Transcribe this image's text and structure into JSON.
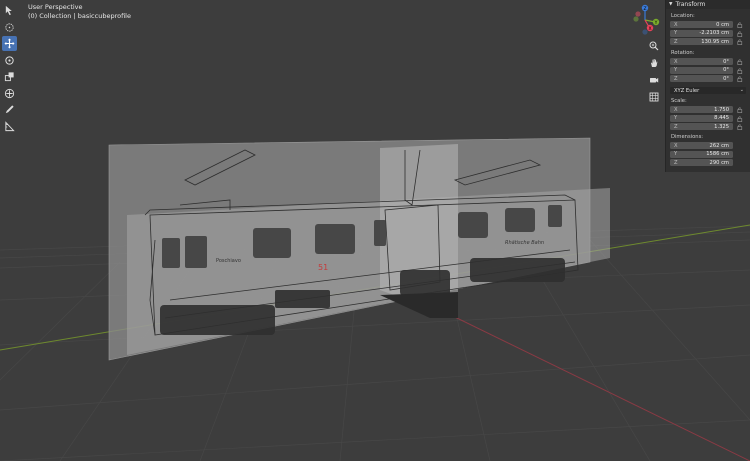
{
  "header": {
    "view_name": "User Perspective",
    "collection_path": "(0) Collection | basiccubeprofile"
  },
  "toolbar": {
    "tools": [
      "select-box-icon",
      "cursor-icon",
      "move-icon",
      "rotate-icon",
      "scale-icon",
      "transform-icon",
      "annotate-icon",
      "measure-icon"
    ],
    "active_tool": "move-icon"
  },
  "nav_buttons": [
    "zoom-icon",
    "hand-pan-icon",
    "camera-icon",
    "grid-view-icon"
  ],
  "gizmo": {
    "labels": {
      "z": "Z",
      "y": "Y",
      "x": "X"
    },
    "colors": {
      "x": "#e8425a",
      "y": "#7aac2c",
      "z": "#3a7ad8"
    }
  },
  "transform": {
    "title": "Transform",
    "location_label": "Location:",
    "location": [
      {
        "axis": "X",
        "value": "0 cm"
      },
      {
        "axis": "Y",
        "value": "-2.2103 cm"
      },
      {
        "axis": "Z",
        "value": "130.95 cm"
      }
    ],
    "rotation_label": "Rotation:",
    "rotation": [
      {
        "axis": "X",
        "value": "0°"
      },
      {
        "axis": "Y",
        "value": "0°"
      },
      {
        "axis": "Z",
        "value": "0°"
      }
    ],
    "rotation_mode": "XYZ Euler",
    "scale_label": "Scale:",
    "scale": [
      {
        "axis": "X",
        "value": "1.750"
      },
      {
        "axis": "Y",
        "value": "8.445"
      },
      {
        "axis": "Z",
        "value": "1.325"
      }
    ],
    "dimensions_label": "Dimensions:",
    "dimensions": [
      {
        "axis": "X",
        "value": "262 cm"
      },
      {
        "axis": "Y",
        "value": "1586 cm"
      },
      {
        "axis": "Z",
        "value": "290 cm"
      }
    ]
  },
  "scene": {
    "car_name_text": "Poschiavo",
    "car_number": "51",
    "livery_text": "Rhätische Bahn"
  },
  "colors": {
    "viewport_bg": "#3d3d3d",
    "grid": "#474747",
    "x_axis": "#8a3a44",
    "y_axis": "#6e8a2e",
    "active_tool": "#4772b3"
  }
}
